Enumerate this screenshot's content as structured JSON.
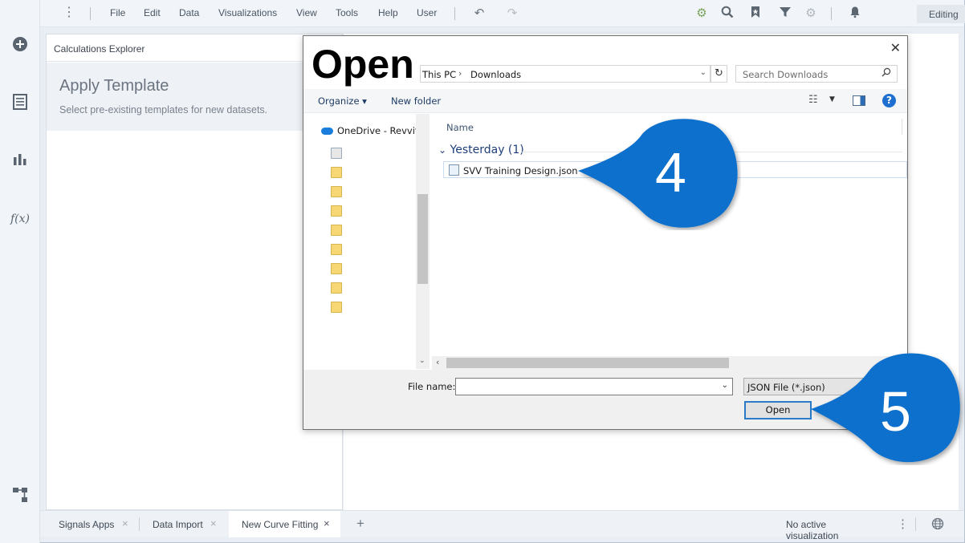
{
  "menu": {
    "items": [
      "File",
      "Edit",
      "Data",
      "Visualizations",
      "View",
      "Tools",
      "Help",
      "User"
    ],
    "mode": "Editing"
  },
  "rail": {
    "icons": [
      "add-icon",
      "list-icon",
      "bar-chart-icon",
      "function-icon",
      "workflow-icon"
    ],
    "function_label": "f(x)"
  },
  "panel": {
    "header": "Calculations Explorer",
    "template_title": "Apply Template",
    "template_subtitle": "Select pre-existing templates for new datasets."
  },
  "bottom_tabs": [
    {
      "label": "Signals Apps",
      "active": false
    },
    {
      "label": "Data Import",
      "active": false
    },
    {
      "label": "New Curve Fitting",
      "active": true
    }
  ],
  "status": "No active visualization",
  "dialog": {
    "title": "Open",
    "breadcrumb": [
      "This PC",
      "Downloads"
    ],
    "search_placeholder": "Search Downloads",
    "organize": "Organize",
    "new_folder": "New folder",
    "nav": {
      "onedrive": "OneDrive - Revvity"
    },
    "column_name": "Name",
    "group": "Yesterday (1)",
    "file": "SVV Training Design.json",
    "file_name_label": "File name:",
    "file_name_value": "",
    "filter": "JSON File (*.json)",
    "open_button": "Open"
  },
  "callouts": [
    {
      "number": "4",
      "color": "#1070cc"
    },
    {
      "number": "5",
      "color": "#1070cc"
    }
  ]
}
